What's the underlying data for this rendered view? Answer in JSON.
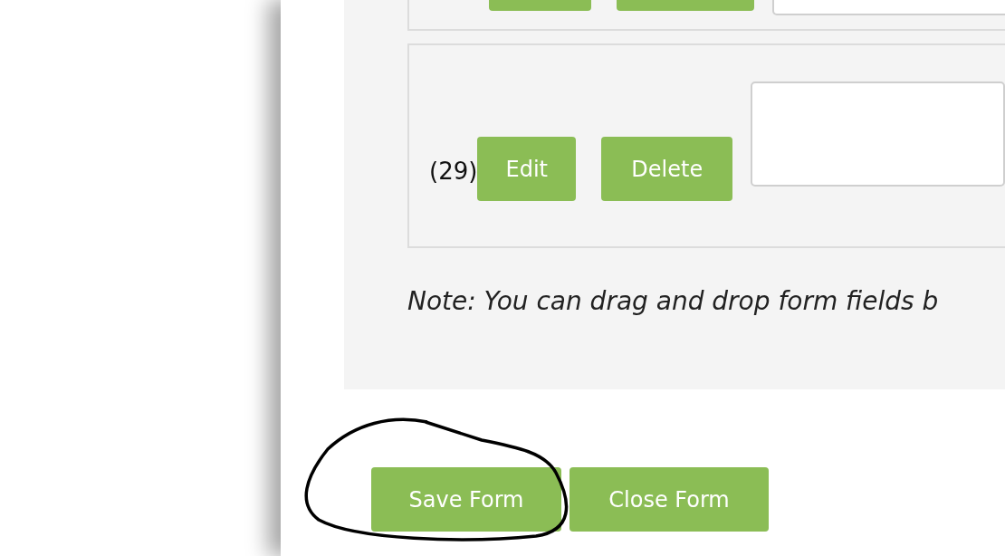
{
  "partial_row_above": true,
  "fields": [
    {
      "number": "(29)",
      "edit_label": "Edit",
      "delete_label": "Delete"
    }
  ],
  "note": "Note: You can drag and drop form fields b",
  "footer_buttons": [
    {
      "label": "Save Form",
      "circled": true
    },
    {
      "label": "Close Form",
      "circled": false
    }
  ]
}
